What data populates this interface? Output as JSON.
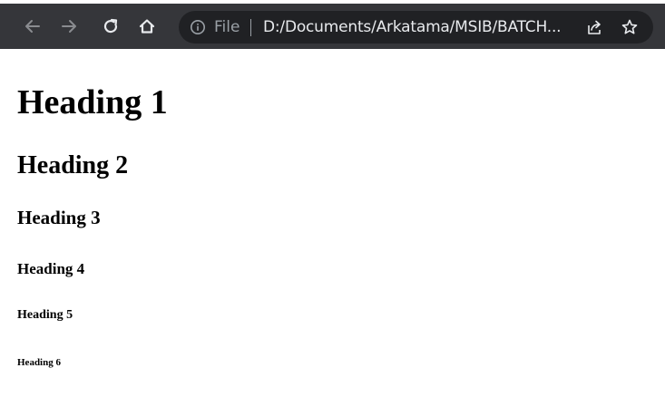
{
  "browser": {
    "nav": {
      "back_icon": "arrow-left-icon",
      "forward_icon": "arrow-right-icon",
      "reload_icon": "reload-icon",
      "home_icon": "home-icon"
    },
    "omnibox": {
      "info_icon": "info-icon",
      "scheme_label": "File",
      "url": "D:/Documents/Arkatama/MSIB/BATCH...",
      "share_icon": "share-icon",
      "bookmark_icon": "star-icon"
    },
    "colors": {
      "toolbar": "#35363a",
      "omnibox": "#202124",
      "icon": "#e8eaed",
      "muted": "#9aa0a6"
    }
  },
  "page": {
    "headings": {
      "h1": "Heading 1",
      "h2": "Heading 2",
      "h3": "Heading 3",
      "h4": "Heading 4",
      "h5": "Heading 5",
      "h6": "Heading 6"
    }
  }
}
